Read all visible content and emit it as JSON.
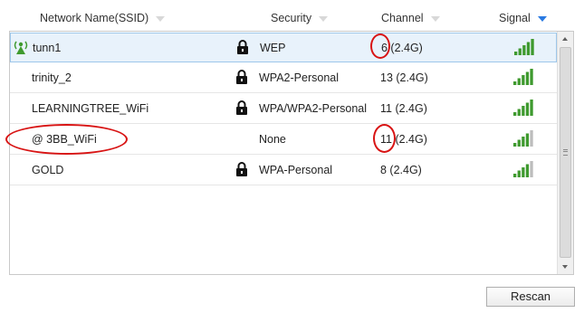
{
  "header": {
    "columns": [
      {
        "label": "Network Name(SSID)"
      },
      {
        "label": "Security"
      },
      {
        "label": "Channel"
      },
      {
        "label": "Signal"
      }
    ]
  },
  "networks": [
    {
      "ssid": "tunn1",
      "locked": true,
      "security": "WEP",
      "channel": "6 (2.4G)",
      "signal": "strong",
      "connected": true
    },
    {
      "ssid": "trinity_2",
      "locked": true,
      "security": "WPA2-Personal",
      "channel": "13 (2.4G)",
      "signal": "strong",
      "connected": false
    },
    {
      "ssid": "LEARNINGTREE_WiFi",
      "locked": true,
      "security": "WPA/WPA2-Personal",
      "channel": "11 (2.4G)",
      "signal": "strong",
      "connected": false
    },
    {
      "ssid": "@ 3BB_WiFi",
      "locked": false,
      "security": "None",
      "channel": "11 (2.4G)",
      "signal": "medium",
      "connected": false
    },
    {
      "ssid": "GOLD",
      "locked": true,
      "security": "WPA-Personal",
      "channel": "8 (2.4G)",
      "signal": "medium",
      "connected": false
    }
  ],
  "rescan_label": "Rescan",
  "colors": {
    "signal_on": "#3f9a2f",
    "signal_off": "#bdbdbd",
    "annotation": "#d81414",
    "sort_active": "#2a7ae2",
    "selected_row": "#e8f2fb"
  }
}
